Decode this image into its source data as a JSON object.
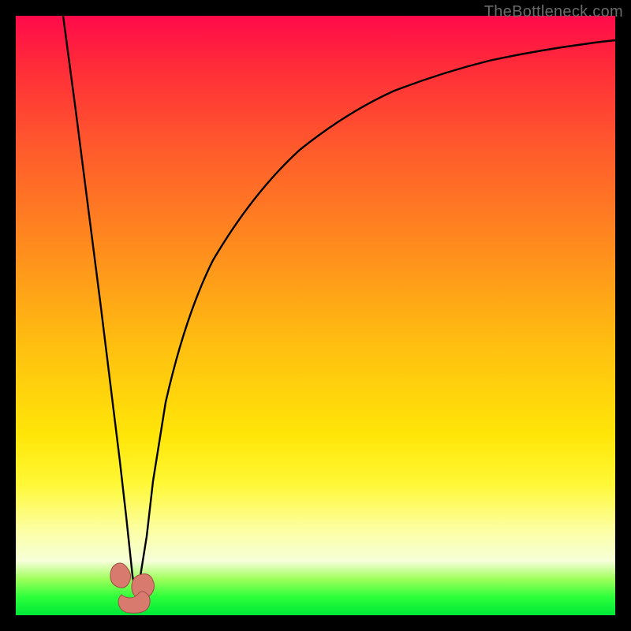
{
  "watermark": "TheBottleneck.com",
  "colors": {
    "frame": "#000000",
    "gradient_top": "#ff0a4a",
    "gradient_mid": "#ffe608",
    "gradient_bottom": "#00e838",
    "curve": "#000000",
    "blob_fill": "#d87a6e",
    "blob_stroke": "#9c4f49"
  },
  "chart_data": {
    "type": "line",
    "title": "",
    "xlabel": "",
    "ylabel": "",
    "xlim": [
      0,
      100
    ],
    "ylim": [
      0,
      100
    ],
    "note": "Axes are unlabeled; values are read as percent of plot width/height. y=100 is top (red), y=0 is bottom (green). Curve is a V-shaped bottleneck chart with minimum near x≈19, y≈2.",
    "series": [
      {
        "name": "bottleneck-curve",
        "x": [
          8,
          10,
          12,
          14,
          16,
          17,
          18,
          19,
          20,
          21,
          22,
          24,
          26,
          30,
          35,
          40,
          45,
          50,
          55,
          60,
          65,
          70,
          75,
          80,
          85,
          90,
          95,
          100
        ],
        "y": [
          100,
          82,
          64,
          46,
          28,
          19,
          10,
          2,
          6,
          15,
          24,
          38,
          48,
          60,
          70,
          76,
          80.5,
          84,
          86.5,
          88.5,
          90,
          91.2,
          92.3,
          93.2,
          94,
          94.7,
          95.3,
          95.8
        ]
      }
    ],
    "markers": [
      {
        "name": "min-left-blob",
        "x": 17.5,
        "y": 6
      },
      {
        "name": "min-right-blob",
        "x": 20.5,
        "y": 4
      },
      {
        "name": "min-joint-blob",
        "x": 19.0,
        "y": 1
      }
    ]
  }
}
